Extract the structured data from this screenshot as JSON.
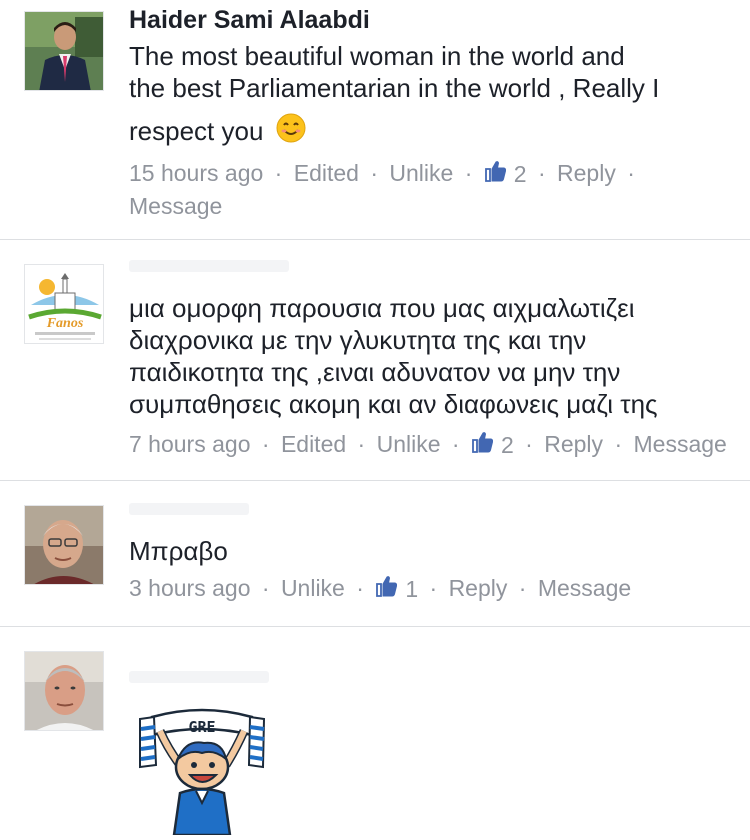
{
  "comments": [
    {
      "author": "Haider Sami Alaabdi",
      "text_line1": "The most beautiful woman in the world and",
      "text_line2": "the best Parliamentarian in the world , Really I",
      "text_line3": "respect you",
      "emoji": "smiling-face-emoji",
      "time": "15 hours ago",
      "edited": "Edited",
      "unlike": "Unlike",
      "likes": "2",
      "reply": "Reply",
      "message": "Message"
    },
    {
      "author": "",
      "text_line1": "μια ομορφη παρουσια που μας αιχμαλωτιζει",
      "text_line2": "διαχρονικα με την γλυκυτητα της και την",
      "text_line3": "παιδικοτητα της ,ειναι αδυνατον να μην την",
      "text_line4": "συμπαθησεις ακομη και αν διαφωνεις μαζι της",
      "avatar_logo_text": "Fanos",
      "time": "7 hours ago",
      "edited": "Edited",
      "unlike": "Unlike",
      "likes": "2",
      "reply": "Reply",
      "message": "Message"
    },
    {
      "author": "",
      "text_line1": "Μπραβο",
      "time": "3 hours ago",
      "unlike": "Unlike",
      "likes": "1",
      "reply": "Reply",
      "message": "Message"
    },
    {
      "author": "",
      "sticker_text": "GRE",
      "sticker": "greek-fan-sticker"
    }
  ],
  "separator": "·",
  "colors": {
    "text": "#1d2129",
    "meta": "#90949c",
    "like_blue": "#4267b2",
    "divider": "#dddfe2",
    "greek_blue": "#1f6fc6"
  }
}
